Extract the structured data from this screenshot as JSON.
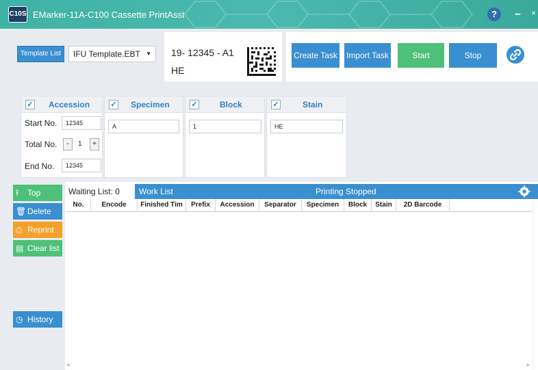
{
  "window": {
    "logo_text": "C10S",
    "title": "EMarker-11A-C100 Cassette PrintAsst",
    "help": "?",
    "minimize": "–",
    "close": "×"
  },
  "toolbar": {
    "template_list_label": "Template List",
    "template_selected": "IFU Template.EBT",
    "preview_code": "19- 12345 - A1",
    "preview_stain": "HE",
    "create_task": "Create Task",
    "import_task": "Import Task",
    "start": "Start",
    "stop": "Stop",
    "link_icon": "link-icon"
  },
  "fields": {
    "accession": {
      "title": "Accession",
      "checked": true,
      "start_label": "Start  No.",
      "start_value": "12345",
      "total_label": "Total No.",
      "total_value": "1",
      "minus": "-",
      "plus": "+",
      "end_label": "End   No.",
      "end_value": "12345"
    },
    "specimen": {
      "title": "Specimen",
      "checked": true,
      "value": "A"
    },
    "block": {
      "title": "Block",
      "checked": true,
      "value": "1"
    },
    "stain": {
      "title": "Stain",
      "checked": true,
      "value": "HE"
    }
  },
  "sidebar": {
    "top": "Top",
    "delete": "Delete",
    "reprint": "Reprint",
    "clear": "Clear list",
    "history": "History"
  },
  "worklist": {
    "waiting": "Waiting List: 0",
    "title": "Work List",
    "status": "Printing Stopped",
    "columns": [
      "No.",
      "Encode",
      "Finished Tim",
      "Prefix",
      "Accession",
      "Separator",
      "Specimen",
      "Block",
      "Stain",
      "2D Barcode"
    ]
  },
  "colors": {
    "accent": "#3a8fd0",
    "start_green": "#4ec07a",
    "reprint_orange": "#f5a02b",
    "titlebar": "#45b3a7"
  }
}
